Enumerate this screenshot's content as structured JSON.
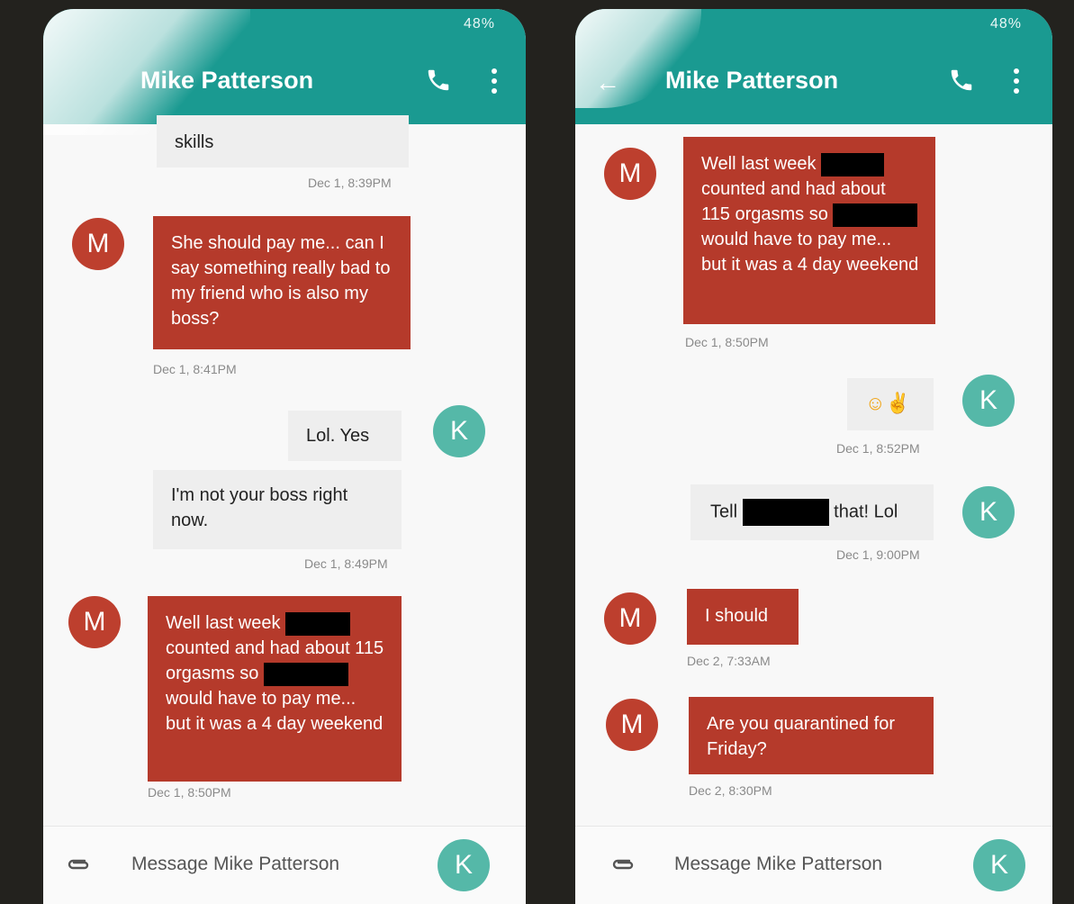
{
  "left": {
    "status": "48%",
    "title": "Mike Patterson",
    "messages": {
      "top_tail": "skills",
      "ts1": "Dec 1, 8:39PM",
      "m1": "She should pay me... can I say something really bad to my friend who is also my boss?",
      "ts2": "Dec 1, 8:41PM",
      "k1": "Lol. Yes",
      "k2": "I'm not your boss right now.",
      "ts3": "Dec 1, 8:49PM",
      "m2_a": "Well last week",
      "m2_b": "counted and had about 115 orgasms so",
      "m2_c": "would have to pay me... but it was a 4 day weekend",
      "ts4": "Dec 1, 8:50PM"
    },
    "composer_placeholder": "Message Mike Patterson"
  },
  "right": {
    "status": "48%",
    "title": "Mike Patterson",
    "messages": {
      "m1_a": "Well last week",
      "m1_b": "counted and had about 115 orgasms so",
      "m1_c": "would have to pay me... but it was a 4 day weekend",
      "ts1": "Dec 1, 8:50PM",
      "ts2": "Dec 1, 8:52PM",
      "k2_a": "Tell",
      "k2_b": "that! Lol",
      "ts3": "Dec 1, 9:00PM",
      "m2": "I should",
      "ts4": "Dec 2, 7:33AM",
      "m3": "Are you quarantined for Friday?",
      "ts5": "Dec 2, 8:30PM"
    },
    "composer_placeholder": "Message Mike Patterson"
  },
  "avatars": {
    "mike": "M",
    "k": "K"
  },
  "colors": {
    "appbar": "#1a9a91",
    "incoming": "#b53a2b",
    "k_avatar": "#55b8a8",
    "m_avatar": "#bd3f2e"
  }
}
